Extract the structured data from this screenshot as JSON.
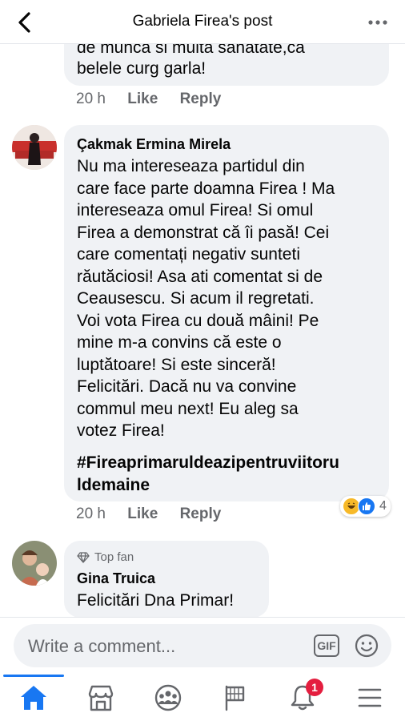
{
  "header": {
    "title": "Gabriela Firea's post"
  },
  "comments": [
    {
      "text_partial_top": "de munca si multa sanatate,ca",
      "text_last": "belele curg garla!",
      "time": "20 h",
      "like": "Like",
      "reply": "Reply"
    },
    {
      "author": "Çakmak Ermina Mirela",
      "lines": [
        "Nu ma intereseaza partidul din",
        "care face parte doamna Firea ! Ma",
        "intereseaza omul Firea! Si omul",
        "Firea a demonstrat că îi pasă! Cei",
        "care comentați negativ sunteti",
        "răutăciosi! Asa ati comentat si de",
        "Ceausescu. Si acum il regretati.",
        "Voi vota Firea cu două mâini! Pe",
        "mine m-a convins că este o",
        "luptătoare! Si este sinceră!",
        "Felicitări. Dacă nu va convine",
        "commul  meu next! Eu aleg sa",
        "votez Firea!"
      ],
      "hashtag": "#Fireaprimaruldeazipentruviitorul demaine",
      "hashtag_lines": [
        "#Fireaprimaruldeazipentruviitoru",
        "ldemaine"
      ],
      "time": "20 h",
      "like": "Like",
      "reply": "Reply",
      "reaction_count": "4",
      "reaction_icons": [
        "haha-icon",
        "like-icon"
      ]
    },
    {
      "badge": "Top fan",
      "author": "Gina Truica",
      "text": "Felicitări Dna Primar!"
    }
  ],
  "composer": {
    "placeholder": "Write a comment...",
    "gif_label": "GIF"
  },
  "tabbar": {
    "notifications_badge": "1",
    "items": [
      "home-icon",
      "marketplace-icon",
      "groups-icon",
      "pages-icon",
      "notifications-icon",
      "menu-icon"
    ]
  },
  "colors": {
    "accent": "#1877f2",
    "bubble": "#f0f2f5",
    "secondary_text": "#65676b",
    "badge": "#e41e3f"
  }
}
